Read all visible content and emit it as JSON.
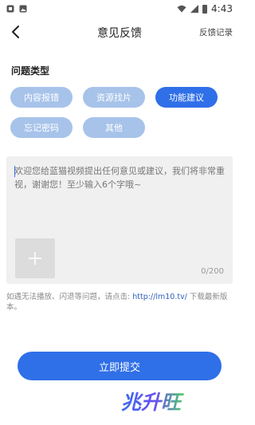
{
  "status_bar": {
    "time": "4:43",
    "icons": [
      "notification-icon",
      "image-icon",
      "wifi-icon",
      "signal-icon",
      "battery-icon"
    ]
  },
  "nav": {
    "title": "意见反馈",
    "back_icon": "chevron-left-icon",
    "history_label": "反馈记录"
  },
  "issue_types": {
    "label": "问题类型",
    "options": [
      {
        "label": "内容报错",
        "selected": false
      },
      {
        "label": "资源找片",
        "selected": false
      },
      {
        "label": "功能建议",
        "selected": true
      },
      {
        "label": "忘记密码",
        "selected": false
      },
      {
        "label": "其他",
        "selected": false
      }
    ]
  },
  "feedback": {
    "placeholder": "欢迎您给蓝猫视频提出任何意见或建议，我们将非常重视，谢谢您！至少输入6个字哦~",
    "add_photo_icon": "plus-icon",
    "char_count": "0/200"
  },
  "notice": {
    "text_before": "如遇无法播放、闪退等问题，请点击: ",
    "link": "http://lm10.tv/",
    "text_after": " 下载最新版本。"
  },
  "submit_label": "立即提交",
  "watermark": "兆升旺",
  "colors": {
    "accent": "#2f6fe8",
    "chip_inactive": "#a7c3ea",
    "input_bg": "#f0f0f0"
  }
}
